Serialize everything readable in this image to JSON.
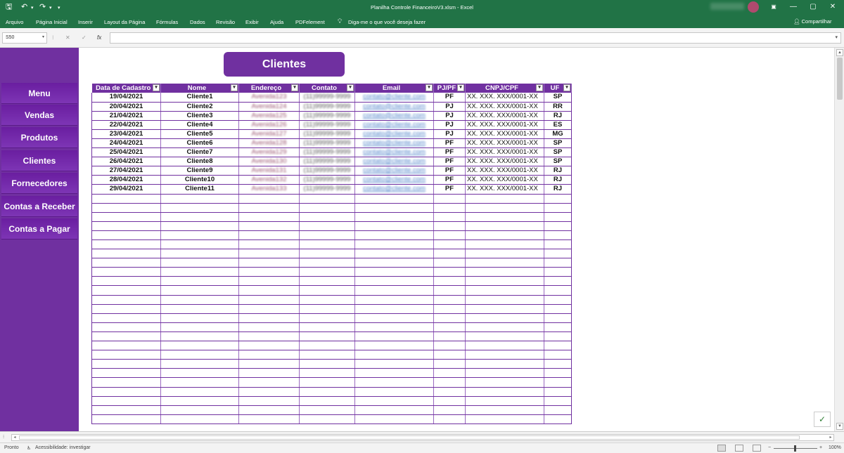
{
  "titlebar": {
    "title": "Planilha Controle FinanceiroV3.xlsm  -  Excel",
    "save_icon": "save-icon",
    "undo_icon": "undo-icon",
    "redo_icon": "redo-icon",
    "minimize": "—",
    "restore": "▢",
    "close": "✕"
  },
  "ribbon": {
    "tabs": [
      "Arquivo",
      "Página Inicial",
      "Inserir",
      "Layout da Página",
      "Fórmulas",
      "Dados",
      "Revisão",
      "Exibir",
      "Ajuda",
      "PDFelement"
    ],
    "tell_me": "Diga-me o que você deseja fazer",
    "share": "Compartilhar"
  },
  "formula_bar": {
    "name_box": "S50",
    "cancel": "✕",
    "enter": "✓",
    "fx": "fx",
    "formula": ""
  },
  "sidebar": {
    "items": [
      "Menu",
      "Vendas",
      "Produtos",
      "Clientes",
      "Fornecedores",
      "Contas a Receber",
      "Contas a Pagar"
    ]
  },
  "page_heading": "Clientes",
  "table": {
    "headers": [
      "Data de Cadastro",
      "Nome",
      "Endereço",
      "Contato",
      "Email",
      "PJ/PF",
      "CNPJ/CPF",
      "UF"
    ],
    "rows": [
      [
        "19/04/2021",
        "Cliente1",
        "Avenida123",
        "(11)99999-9999",
        "contato@cliente.com",
        "PF",
        "XX. XXX. XXX/0001-XX",
        "SP"
      ],
      [
        "20/04/2021",
        "Cliente2",
        "Avenida124",
        "(11)99999-9999",
        "contato@cliente.com",
        "PJ",
        "XX. XXX. XXX/0001-XX",
        "RR"
      ],
      [
        "21/04/2021",
        "Cliente3",
        "Avenida125",
        "(11)99999-9999",
        "contato@cliente.com",
        "PJ",
        "XX. XXX. XXX/0001-XX",
        "RJ"
      ],
      [
        "22/04/2021",
        "Cliente4",
        "Avenida126",
        "(11)99999-9999",
        "contato@cliente.com",
        "PJ",
        "XX. XXX. XXX/0001-XX",
        "ES"
      ],
      [
        "23/04/2021",
        "Cliente5",
        "Avenida127",
        "(11)99999-9999",
        "contato@cliente.com",
        "PJ",
        "XX. XXX. XXX/0001-XX",
        "MG"
      ],
      [
        "24/04/2021",
        "Cliente6",
        "Avenida128",
        "(11)99999-9999",
        "contato@cliente.com",
        "PF",
        "XX. XXX. XXX/0001-XX",
        "SP"
      ],
      [
        "25/04/2021",
        "Cliente7",
        "Avenida129",
        "(11)99999-9999",
        "contato@cliente.com",
        "PF",
        "XX. XXX. XXX/0001-XX",
        "SP"
      ],
      [
        "26/04/2021",
        "Cliente8",
        "Avenida130",
        "(11)99999-9999",
        "contato@cliente.com",
        "PF",
        "XX. XXX. XXX/0001-XX",
        "SP"
      ],
      [
        "27/04/2021",
        "Cliente9",
        "Avenida131",
        "(11)99999-9999",
        "contato@cliente.com",
        "PF",
        "XX. XXX. XXX/0001-XX",
        "RJ"
      ],
      [
        "28/04/2021",
        "Cliente10",
        "Avenida132",
        "(11)99999-9999",
        "contato@cliente.com",
        "PF",
        "XX. XXX. XXX/0001-XX",
        "RJ"
      ],
      [
        "29/04/2021",
        "Cliente11",
        "Avenida133",
        "(11)99999-9999",
        "contato@cliente.com",
        "PF",
        "XX. XXX. XXX/0001-XX",
        "RJ"
      ]
    ],
    "empty_rows": 25
  },
  "statusbar": {
    "ready": "Pronto",
    "accessibility": "Acessibilidade: investigar",
    "zoom": "100%",
    "zoom_minus": "−",
    "zoom_plus": "+"
  },
  "colors": {
    "excel_green": "#217346",
    "brand_purple": "#7030a0"
  }
}
